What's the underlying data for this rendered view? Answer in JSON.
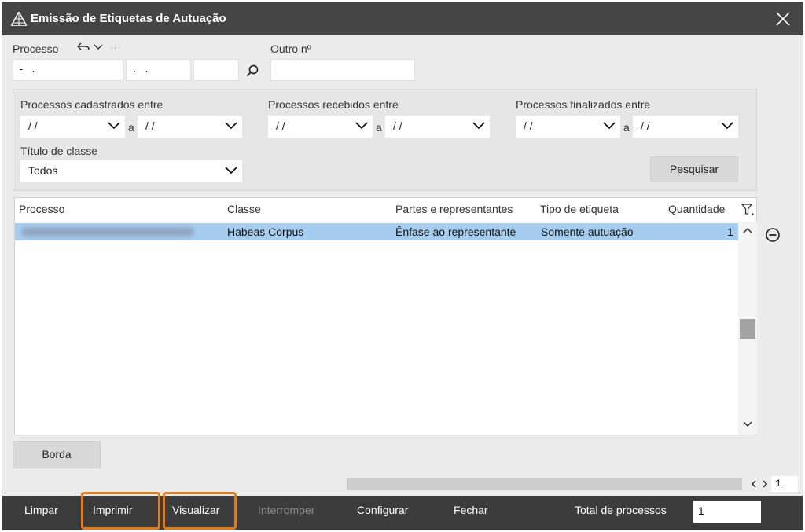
{
  "window": {
    "title": "Emissão de Etiquetas de Autuação"
  },
  "processo": {
    "label": "Processo",
    "field1": "- .",
    "field2": ". .",
    "field3": "",
    "more": "···"
  },
  "outro": {
    "label": "Outro nº",
    "value": ""
  },
  "filters": {
    "cadastrados": {
      "label": "Processos cadastrados entre",
      "from": "/ /",
      "to": "/ /"
    },
    "recebidos": {
      "label": "Processos recebidos entre",
      "from": "/ /",
      "to": "/ /"
    },
    "finalizados": {
      "label": "Processos finalizados entre",
      "from": "/ /",
      "to": "/ /"
    },
    "sep": "a",
    "titulo": {
      "label": "Título de classe",
      "value": "Todos"
    },
    "pesquisar": "Pesquisar"
  },
  "grid": {
    "headers": {
      "processo": "Processo",
      "classe": "Classe",
      "partes": "Partes e representantes",
      "tipo": "Tipo de etiqueta",
      "quantidade": "Quantidade"
    },
    "rows": [
      {
        "processo": "",
        "classe": "Habeas Corpus",
        "partes": "Ênfase ao representante",
        "tipo": "Somente autuação",
        "quantidade": "1"
      }
    ]
  },
  "borda": "Borda",
  "pager": {
    "page": "1"
  },
  "toolbar": {
    "limpar_pre": "",
    "limpar_u": "L",
    "limpar_post": "impar",
    "imprimir_pre": "",
    "imprimir_u": "I",
    "imprimir_post": "mprimir",
    "visualizar_pre": "",
    "visualizar_u": "V",
    "visualizar_post": "isualizar",
    "interromper_pre": "Inte",
    "interromper_u": "r",
    "interromper_post": "romper",
    "configurar_pre": "",
    "configurar_u": "C",
    "configurar_post": "onfigurar",
    "fechar_pre": "",
    "fechar_u": "F",
    "fechar_post": "echar",
    "total_label": "Total de processos",
    "total_value": "1"
  },
  "colors": {
    "titlebar": "#454545",
    "toolbar": "#3c3c3c",
    "selection": "#a6cdf0",
    "highlight": "#e07b1e"
  }
}
